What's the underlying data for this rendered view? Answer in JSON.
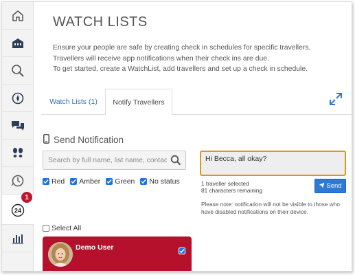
{
  "sidebar": {
    "items": [
      {
        "icon": "home-icon"
      },
      {
        "icon": "building-icon"
      },
      {
        "icon": "search-icon"
      },
      {
        "icon": "compass-icon"
      },
      {
        "icon": "chat-icon"
      },
      {
        "icon": "footprints-icon"
      },
      {
        "icon": "clock-check-icon"
      },
      {
        "icon": "24-hour-icon",
        "badge": "1"
      },
      {
        "icon": "bar-chart-icon"
      }
    ]
  },
  "page": {
    "title": "WATCH LISTS",
    "intro": [
      "Ensure your people are safe by creating check in schedules for specific travellers.",
      "Travellers will receive app notifications when their check ins are due.",
      "To get started, create a WatchList, add travellers and set up a check in schedule."
    ]
  },
  "tabs": {
    "watch_lists": "Watch Lists (1)",
    "notify_travellers": "Notify Travellers",
    "active": "notify_travellers"
  },
  "send": {
    "heading": "Send Notification",
    "search_placeholder": "Search by full name, list name, contact",
    "filters": [
      {
        "label": "Red",
        "checked": true
      },
      {
        "label": "Amber",
        "checked": true
      },
      {
        "label": "Green",
        "checked": true
      },
      {
        "label": "No status",
        "checked": true
      }
    ],
    "select_all": "Select All",
    "users": [
      {
        "name": "Demo User",
        "selected": true
      }
    ],
    "message": "Hi Becca, all okay?",
    "selected_count": "1 traveller selected",
    "chars_remaining": "81 characters remaining",
    "send_label": "Send",
    "note": [
      "Please note: notification will not be visible to those who",
      "have disabled notifications on their device."
    ]
  },
  "colors": {
    "accent": "#2c7ad6",
    "user_card": "#b5112c",
    "badge": "#c0152f",
    "focus_border": "#d89a1b",
    "tab_link": "#2f6fb3"
  }
}
